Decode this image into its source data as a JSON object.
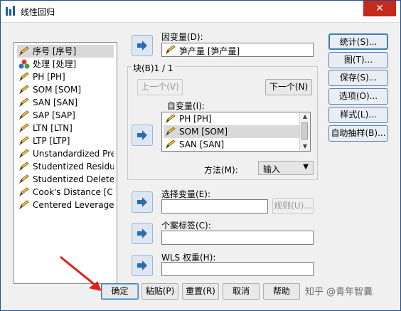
{
  "window": {
    "title": "线性回归",
    "close_glyph": "✕"
  },
  "variables": [
    {
      "label": "序号 [序号]",
      "icon": "pencil-icon",
      "selected": true
    },
    {
      "label": "处理 [处理]",
      "icon": "nominal-balls-icon"
    },
    {
      "label": "PH    [PH]",
      "icon": "pencil-icon"
    },
    {
      "label": "SOM    [SOM]",
      "icon": "pencil-icon"
    },
    {
      "label": "SAN    [SAN]",
      "icon": "pencil-icon"
    },
    {
      "label": "SAP    [SAP]",
      "icon": "pencil-icon"
    },
    {
      "label": "LTN    [LTN]",
      "icon": "pencil-icon"
    },
    {
      "label": "LTP    [LTP]",
      "icon": "pencil-icon"
    },
    {
      "label": "Unstandardized Pre...",
      "icon": "pencil-icon"
    },
    {
      "label": "Studentized Residu...",
      "icon": "pencil-icon"
    },
    {
      "label": "Studentized Deleted...",
      "icon": "pencil-icon"
    },
    {
      "label": "Cook's Distance [C...",
      "icon": "pencil-icon"
    },
    {
      "label": "Centered Leverage ...",
      "icon": "pencil-icon"
    }
  ],
  "dependent": {
    "label": "因变量(D):",
    "value": "笋产量      [笋产量]"
  },
  "block": {
    "label": "块(B)1 / 1",
    "prev": "上一个(V)",
    "next": "下一个(N)"
  },
  "independent": {
    "label": "自变量(I):",
    "items": [
      {
        "label": "PH    [PH]"
      },
      {
        "label": "SOM    [SOM]",
        "selected": true
      },
      {
        "label": "SAN    [SAN]"
      }
    ]
  },
  "method": {
    "label": "方法(M):",
    "value": "输入"
  },
  "selection": {
    "label": "选择变量(E):",
    "value": "",
    "rule_button": "规则(U)..."
  },
  "case_label": {
    "label": "个案标签(C):",
    "value": ""
  },
  "wls": {
    "label": "WLS 权重(H):",
    "value": ""
  },
  "side_buttons": [
    "统计(S)...",
    "图(T)...",
    "保存(S)...",
    "选项(O)...",
    "样式(L)...",
    "自助抽样(B)..."
  ],
  "bottom_buttons": [
    "确定",
    "粘贴(P)",
    "重置(R)",
    "取消",
    "帮助"
  ],
  "watermark": "知乎 @青年智囊",
  "colors": {
    "accent": "#2b6cb0",
    "arrow_annotation": "#e0201b"
  }
}
